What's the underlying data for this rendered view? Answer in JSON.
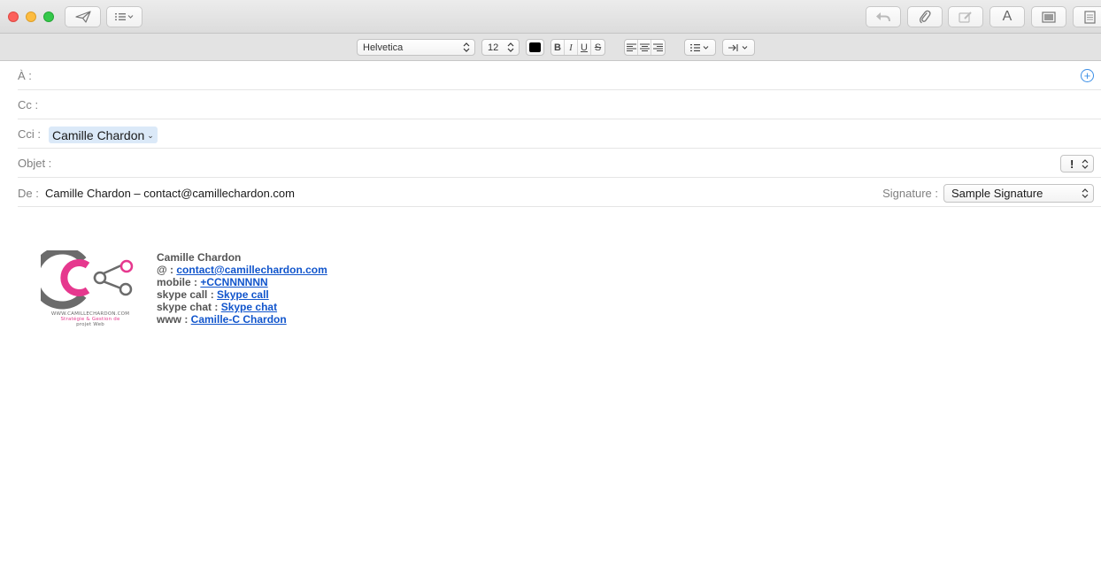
{
  "toolbar": {
    "send_icon": "paper-plane-icon",
    "header_fields_icon": "list-icon",
    "reply_icon": "reply-arrow-icon",
    "attach_icon": "paperclip-icon",
    "markup_icon": "markup-icon",
    "font_label": "A",
    "photo_icon": "photo-icon",
    "stationery_icon": "stationery-icon"
  },
  "format": {
    "font_family": "Helvetica",
    "font_size": "12",
    "color_swatch": "#000000",
    "bold": "B",
    "italic": "I",
    "underline": "U",
    "strike": "S"
  },
  "fields": {
    "to_label": "À :",
    "cc_label": "Cc :",
    "bcc_label": "Cci :",
    "bcc_token": "Camille Chardon",
    "subject_label": "Objet :",
    "priority_label": "!",
    "from_label": "De :",
    "from_value": "Camille Chardon – contact@camillechardon.com",
    "signature_label": "Signature :",
    "signature_value": "Sample Signature"
  },
  "signature": {
    "logo_line1": "WWW.CAMILLECHARDON.COM",
    "logo_line2": "Stratégie & Gestion de",
    "logo_line3": "projet Web",
    "name": "Camille Chardon",
    "email_prefix": "@ : ",
    "email": "contact@camillechardon.com",
    "mobile_prefix": "mobile : ",
    "mobile": "+CCNNNNNN",
    "skype_call_prefix": "skype call : ",
    "skype_call": "Skype call",
    "skype_chat_prefix": "skype chat : ",
    "skype_chat": "Skype chat",
    "www_prefix": "www : ",
    "www": "Camille-C Chardon"
  },
  "colors": {
    "accent": "#3a8ee6",
    "link": "#1155cc",
    "logo_pink": "#e6388e",
    "logo_gray": "#6b6b6b"
  }
}
